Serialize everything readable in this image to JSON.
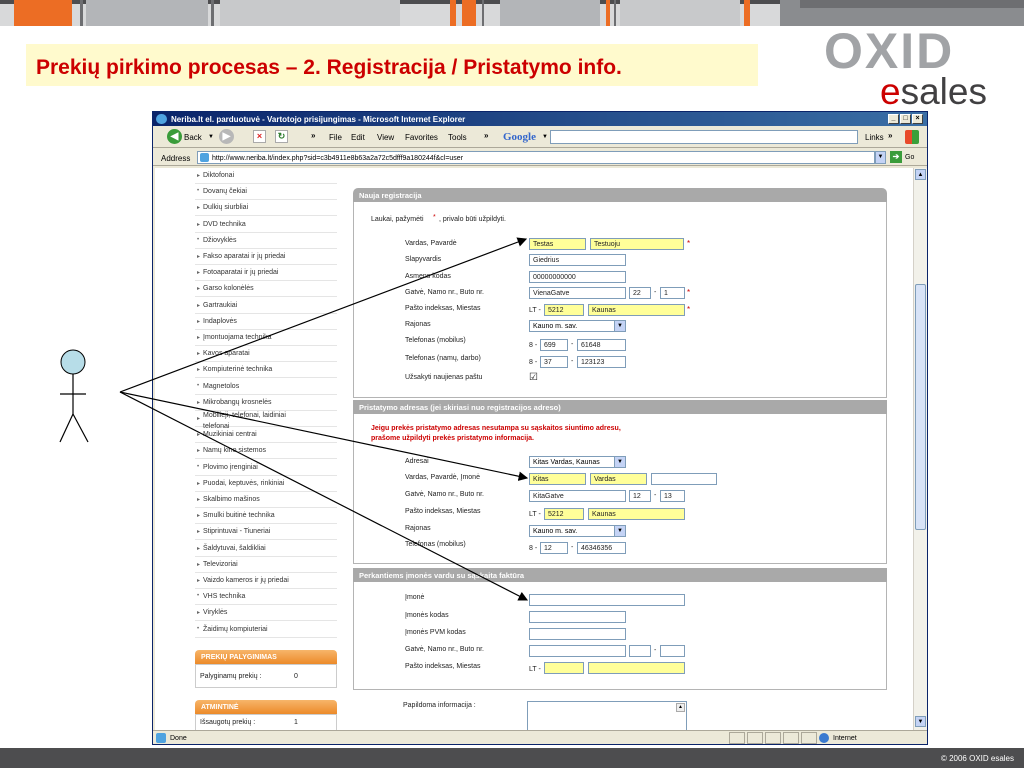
{
  "slide": {
    "title": "Prekių pirkimo procesas – 2. Registracija / Pristatymo info.",
    "logo_top": "OXID",
    "logo_e": "e",
    "logo_rest": "sales",
    "footer": "© 2006 OXID esales"
  },
  "browser": {
    "window_title": "Neriba.lt el. parduotuvė - Vartotojo prisijungimas - Microsoft Internet Explorer",
    "toolbar": {
      "back": "Back",
      "menu": [
        "File",
        "Edit",
        "View",
        "Favorites",
        "Tools"
      ],
      "google": "Google",
      "links": "Links"
    },
    "address_label": "Address",
    "address_url": "http://www.neriba.lt/index.php?sid=c3b4911e8b63a2a72c5dfff9a180244f&cl=user",
    "go": "Go",
    "status_done": "Done",
    "status_zone": "Internet"
  },
  "sidebar": {
    "categories": [
      {
        "label": "Diktofonai",
        "bullet": "▸"
      },
      {
        "label": "Dovanų čekiai",
        "bullet": "•"
      },
      {
        "label": "Dulkių siurbliai",
        "bullet": "▸"
      },
      {
        "label": "DVD technika",
        "bullet": "▸"
      },
      {
        "label": "Džiovyklės",
        "bullet": "•"
      },
      {
        "label": "Fakso aparatai ir jų priedai",
        "bullet": "▸"
      },
      {
        "label": "Fotoaparatai ir jų priedai",
        "bullet": "▸"
      },
      {
        "label": "Garso kolonėlės",
        "bullet": "▸"
      },
      {
        "label": "Gartraukiai",
        "bullet": "▸"
      },
      {
        "label": "Indaplovės",
        "bullet": "▸"
      },
      {
        "label": "Įmontuojama technika",
        "bullet": "▸"
      },
      {
        "label": "Kavos aparatai",
        "bullet": "▸"
      },
      {
        "label": "Kompiuterinė technika",
        "bullet": "▸"
      },
      {
        "label": "Magnetolos",
        "bullet": "•"
      },
      {
        "label": "Mikrobangų krosnelės",
        "bullet": "▸"
      },
      {
        "label": "Mobilieji, telefonai, laidiniai",
        "label2": "telefonai",
        "bullet": "▸"
      },
      {
        "label": "Muzikiniai centrai",
        "bullet": "▸"
      },
      {
        "label": "Namų kino sistemos",
        "bullet": "▸"
      },
      {
        "label": "Plovimo įrenginiai",
        "bullet": "•"
      },
      {
        "label": "Puodai, keptuvės, rinkiniai",
        "bullet": "▸"
      },
      {
        "label": "Skalbimo mašinos",
        "bullet": "▸"
      },
      {
        "label": "Smulki buitinė technika",
        "bullet": "▸"
      },
      {
        "label": "Stiprintuvai - Tiuneriai",
        "bullet": "▸"
      },
      {
        "label": "Šaldytuvai, šaldikliai",
        "bullet": "▸"
      },
      {
        "label": "Televizoriai",
        "bullet": "▸"
      },
      {
        "label": "Vaizdo kameros ir jų priedai",
        "bullet": "▸"
      },
      {
        "label": "VHS technika",
        "bullet": "•"
      },
      {
        "label": "Viryklės",
        "bullet": "▸"
      },
      {
        "label": "Žaidimų kompiuteriai",
        "bullet": "•"
      }
    ],
    "compare": {
      "header": "PREKIŲ PALYGINIMAS",
      "label": "Palyginamų prekių :",
      "value": "0"
    },
    "memo": {
      "header": "ATMINTINĖ",
      "label": "Išsaugotų prekių :",
      "value": "1"
    }
  },
  "registration": {
    "header": "Nauja registracija",
    "note_pre": "Laukai, pažymėti",
    "note_star": "*",
    "note_post": ", privalo būti užpildyti.",
    "labels": {
      "name": "Vardas, Pavardė",
      "nick": "Slapyvardis",
      "code": "Asmens kodas",
      "street": "Gatvė, Namo nr., Buto nr.",
      "zip": "Pašto indeksas, Miestas",
      "district": "Rajonas",
      "mobile": "Telefonas (mobilus)",
      "phone": "Telefonas (namų, darbo)",
      "newsletter": "Užsakyti naujienas paštu"
    },
    "values": {
      "first_name": "Testas",
      "last_name": "Testuoju",
      "nick": "Giedrius",
      "code": "00000000000",
      "street": "VienaGatve",
      "house": "22",
      "flat": "1",
      "zip_prefix": "LT -",
      "zip": "5212",
      "city": "Kaunas",
      "district": "Kauno m. sav.",
      "mobile_prefix": "8 -",
      "mobile_code": "699",
      "mobile_number": "61648",
      "phone_prefix": "8 -",
      "phone_code": "37",
      "phone_number": "123123",
      "newsletter_check": "☑"
    }
  },
  "delivery": {
    "header": "Pristatymo adresas (jei skiriasi nuo registracijos adreso)",
    "warning1": "Jeigu prekės pristatymo adresas nesutampa su sąskaitos siuntimo adresu,",
    "warning2": "prašome užpildyti prekės pristatymo informacija.",
    "labels": {
      "address": "Adresai",
      "name": "Vardas, Pavardė, Įmonė",
      "street": "Gatvė, Namo nr., Buto nr.",
      "zip": "Pašto indeksas, Miestas",
      "district": "Rajonas",
      "mobile": "Telefonas (mobilus)"
    },
    "values": {
      "address_select": "Kitas Vardas, Kaunas",
      "first_name": "Kitas",
      "last_name": "Vardas",
      "company": "",
      "street": "KitaGatve",
      "house": "12",
      "flat": "13",
      "zip_prefix": "LT -",
      "zip": "5212",
      "city": "Kaunas",
      "district": "Kauno m. sav.",
      "mobile_prefix": "8 -",
      "mobile_code": "12",
      "mobile_number": "46346356"
    }
  },
  "company": {
    "header": "Perkantiems įmonės vardu su sąskaita faktūra",
    "labels": {
      "company": "Įmonė",
      "code": "Įmonės kodas",
      "vat": "Įmonės PVM kodas",
      "street": "Gatvė, Namo nr., Buto nr.",
      "zip": "Pašto indeksas, Miestas"
    },
    "zip_prefix": "LT -"
  },
  "extra": {
    "label": "Papildoma informacija :"
  },
  "colors": {
    "title_text": "#cc0000",
    "title_bg": "#fffacd",
    "accent_orange": "#ec6d24",
    "required_yellow": "#ffff99",
    "section_header": "#a9a9a9",
    "ie_blue": "#0a246a"
  }
}
